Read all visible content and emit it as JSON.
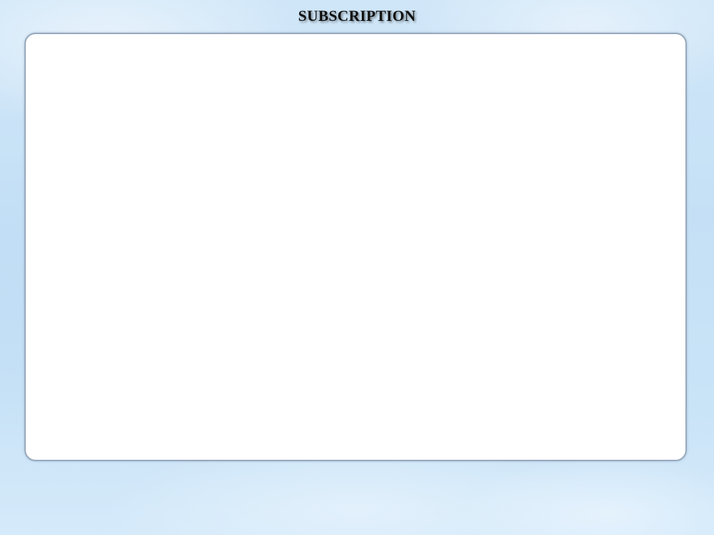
{
  "screen": {
    "title": "SUBSCRIPTION"
  },
  "colors": {
    "background": "#c9e3f7",
    "panel_fill": "#ffffff",
    "panel_border": "#98a9bd",
    "title_text": "#111111"
  },
  "content": {
    "items": []
  }
}
